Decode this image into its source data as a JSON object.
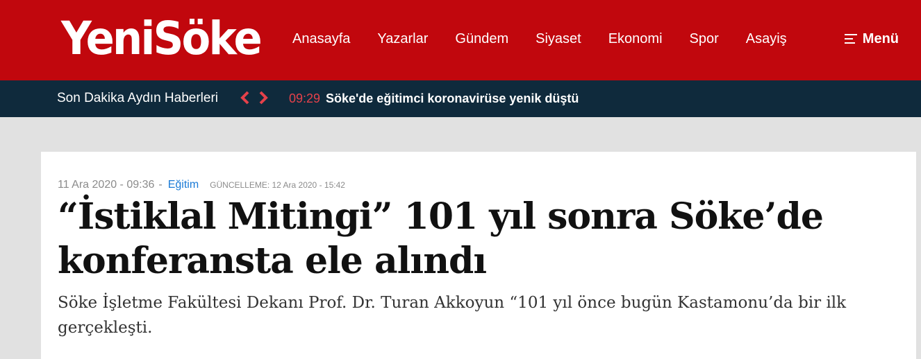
{
  "header": {
    "logo_text": "YeniSöke",
    "nav_items": [
      "Anasayfa",
      "Yazarlar",
      "Gündem",
      "Siyaset",
      "Ekonomi",
      "Spor",
      "Asayiş"
    ],
    "menu_label": "Menü",
    "colors": {
      "brand": "#c1070d",
      "ticker_bg": "#0f2a3c",
      "accent_time": "#e5414a"
    }
  },
  "ticker": {
    "label": "Son Dakika Aydın Haberleri",
    "prev_icon": "chevron-left-icon",
    "next_icon": "chevron-right-icon",
    "time": "09:29",
    "headline": "Söke'de eğitimci koronavirüse yenik düştü"
  },
  "article": {
    "date": "11 Ara 2020 - 09:36",
    "separator": "-",
    "category": "Eğitim",
    "updated": "GÜNCELLEME: 12 Ara 2020 - 15:42",
    "title": "“İstiklal Mitingi” 101 yıl sonra Söke’de konferansta ele alındı",
    "summary": "Söke İşletme Fakültesi Dekanı Prof. Dr. Turan Akkoyun “101 yıl önce bugün Kastamonu’da bir ilk gerçekleşti."
  }
}
